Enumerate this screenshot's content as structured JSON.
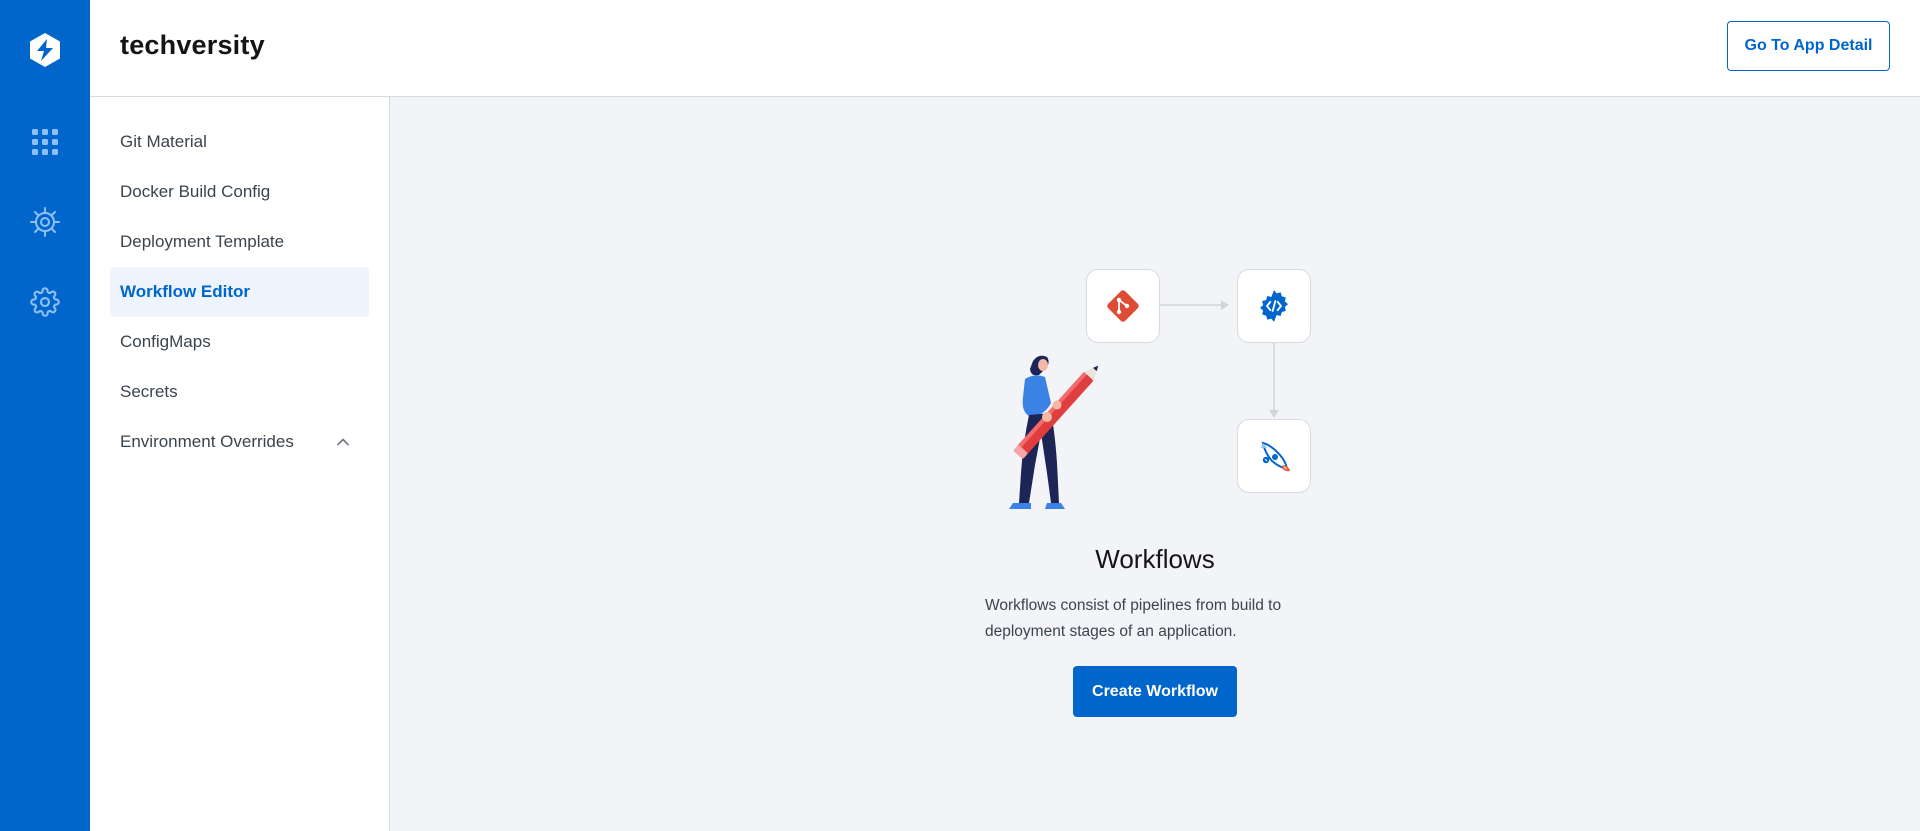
{
  "header": {
    "app_name": "techversity",
    "go_to_app_detail": "Go To App Detail"
  },
  "sidebar": {
    "items": [
      {
        "label": "Git Material"
      },
      {
        "label": "Docker Build Config"
      },
      {
        "label": "Deployment Template"
      },
      {
        "label": "Workflow Editor",
        "active": true
      },
      {
        "label": "ConfigMaps"
      },
      {
        "label": "Secrets"
      },
      {
        "label": "Environment Overrides",
        "expandable": true,
        "expanded": true
      }
    ]
  },
  "empty_state": {
    "title": "Workflows",
    "description": "Workflows consist of pipelines from build to deployment stages of an application.",
    "button_label": "Create Workflow"
  },
  "icons": {
    "rail": [
      "devtron-logo-icon",
      "apps-grid-icon",
      "chart-store-icon",
      "global-config-gear-icon"
    ],
    "nodes": [
      "git-icon",
      "build-code-gear-icon",
      "deploy-rocket-icon"
    ]
  },
  "colors": {
    "primary": "#0066cc",
    "active_bg": "#eef4fd",
    "page_bg": "#f2f4f7",
    "git_red": "#de4c36"
  }
}
